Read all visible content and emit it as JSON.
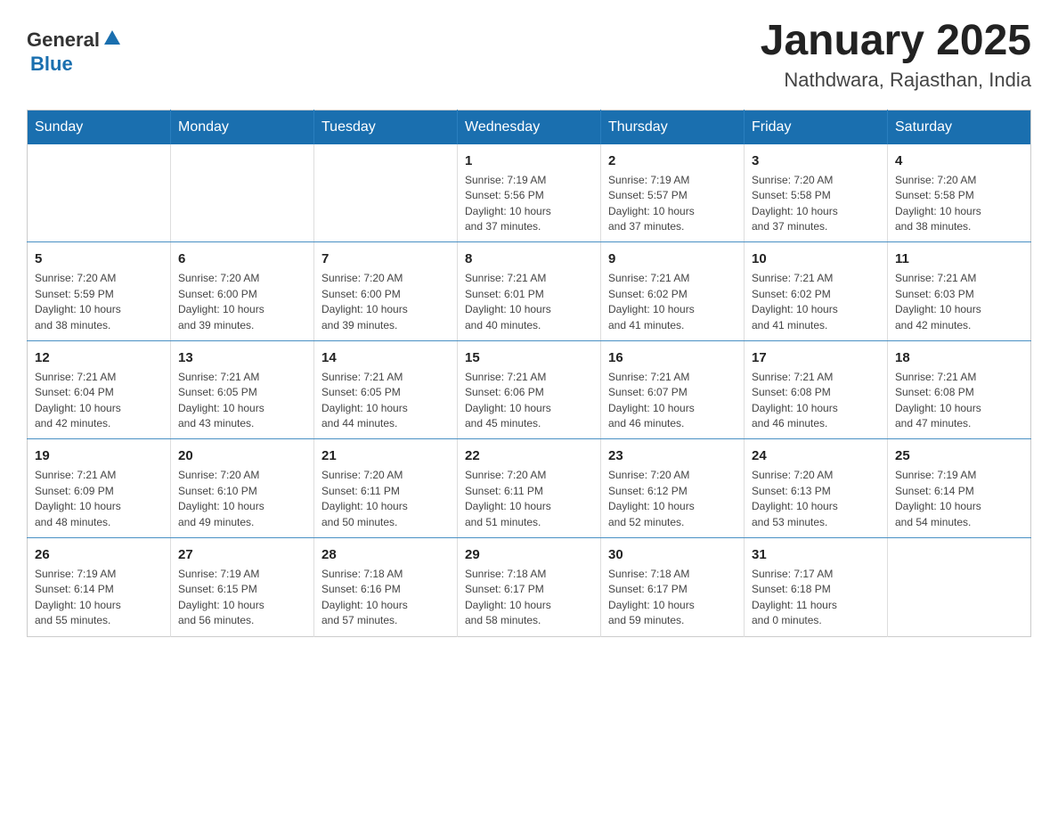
{
  "header": {
    "logo_general": "General",
    "logo_blue": "Blue",
    "month_year": "January 2025",
    "location": "Nathdwara, Rajasthan, India"
  },
  "days_of_week": [
    "Sunday",
    "Monday",
    "Tuesday",
    "Wednesday",
    "Thursday",
    "Friday",
    "Saturday"
  ],
  "weeks": [
    [
      {
        "day": "",
        "info": ""
      },
      {
        "day": "",
        "info": ""
      },
      {
        "day": "",
        "info": ""
      },
      {
        "day": "1",
        "info": "Sunrise: 7:19 AM\nSunset: 5:56 PM\nDaylight: 10 hours\nand 37 minutes."
      },
      {
        "day": "2",
        "info": "Sunrise: 7:19 AM\nSunset: 5:57 PM\nDaylight: 10 hours\nand 37 minutes."
      },
      {
        "day": "3",
        "info": "Sunrise: 7:20 AM\nSunset: 5:58 PM\nDaylight: 10 hours\nand 37 minutes."
      },
      {
        "day": "4",
        "info": "Sunrise: 7:20 AM\nSunset: 5:58 PM\nDaylight: 10 hours\nand 38 minutes."
      }
    ],
    [
      {
        "day": "5",
        "info": "Sunrise: 7:20 AM\nSunset: 5:59 PM\nDaylight: 10 hours\nand 38 minutes."
      },
      {
        "day": "6",
        "info": "Sunrise: 7:20 AM\nSunset: 6:00 PM\nDaylight: 10 hours\nand 39 minutes."
      },
      {
        "day": "7",
        "info": "Sunrise: 7:20 AM\nSunset: 6:00 PM\nDaylight: 10 hours\nand 39 minutes."
      },
      {
        "day": "8",
        "info": "Sunrise: 7:21 AM\nSunset: 6:01 PM\nDaylight: 10 hours\nand 40 minutes."
      },
      {
        "day": "9",
        "info": "Sunrise: 7:21 AM\nSunset: 6:02 PM\nDaylight: 10 hours\nand 41 minutes."
      },
      {
        "day": "10",
        "info": "Sunrise: 7:21 AM\nSunset: 6:02 PM\nDaylight: 10 hours\nand 41 minutes."
      },
      {
        "day": "11",
        "info": "Sunrise: 7:21 AM\nSunset: 6:03 PM\nDaylight: 10 hours\nand 42 minutes."
      }
    ],
    [
      {
        "day": "12",
        "info": "Sunrise: 7:21 AM\nSunset: 6:04 PM\nDaylight: 10 hours\nand 42 minutes."
      },
      {
        "day": "13",
        "info": "Sunrise: 7:21 AM\nSunset: 6:05 PM\nDaylight: 10 hours\nand 43 minutes."
      },
      {
        "day": "14",
        "info": "Sunrise: 7:21 AM\nSunset: 6:05 PM\nDaylight: 10 hours\nand 44 minutes."
      },
      {
        "day": "15",
        "info": "Sunrise: 7:21 AM\nSunset: 6:06 PM\nDaylight: 10 hours\nand 45 minutes."
      },
      {
        "day": "16",
        "info": "Sunrise: 7:21 AM\nSunset: 6:07 PM\nDaylight: 10 hours\nand 46 minutes."
      },
      {
        "day": "17",
        "info": "Sunrise: 7:21 AM\nSunset: 6:08 PM\nDaylight: 10 hours\nand 46 minutes."
      },
      {
        "day": "18",
        "info": "Sunrise: 7:21 AM\nSunset: 6:08 PM\nDaylight: 10 hours\nand 47 minutes."
      }
    ],
    [
      {
        "day": "19",
        "info": "Sunrise: 7:21 AM\nSunset: 6:09 PM\nDaylight: 10 hours\nand 48 minutes."
      },
      {
        "day": "20",
        "info": "Sunrise: 7:20 AM\nSunset: 6:10 PM\nDaylight: 10 hours\nand 49 minutes."
      },
      {
        "day": "21",
        "info": "Sunrise: 7:20 AM\nSunset: 6:11 PM\nDaylight: 10 hours\nand 50 minutes."
      },
      {
        "day": "22",
        "info": "Sunrise: 7:20 AM\nSunset: 6:11 PM\nDaylight: 10 hours\nand 51 minutes."
      },
      {
        "day": "23",
        "info": "Sunrise: 7:20 AM\nSunset: 6:12 PM\nDaylight: 10 hours\nand 52 minutes."
      },
      {
        "day": "24",
        "info": "Sunrise: 7:20 AM\nSunset: 6:13 PM\nDaylight: 10 hours\nand 53 minutes."
      },
      {
        "day": "25",
        "info": "Sunrise: 7:19 AM\nSunset: 6:14 PM\nDaylight: 10 hours\nand 54 minutes."
      }
    ],
    [
      {
        "day": "26",
        "info": "Sunrise: 7:19 AM\nSunset: 6:14 PM\nDaylight: 10 hours\nand 55 minutes."
      },
      {
        "day": "27",
        "info": "Sunrise: 7:19 AM\nSunset: 6:15 PM\nDaylight: 10 hours\nand 56 minutes."
      },
      {
        "day": "28",
        "info": "Sunrise: 7:18 AM\nSunset: 6:16 PM\nDaylight: 10 hours\nand 57 minutes."
      },
      {
        "day": "29",
        "info": "Sunrise: 7:18 AM\nSunset: 6:17 PM\nDaylight: 10 hours\nand 58 minutes."
      },
      {
        "day": "30",
        "info": "Sunrise: 7:18 AM\nSunset: 6:17 PM\nDaylight: 10 hours\nand 59 minutes."
      },
      {
        "day": "31",
        "info": "Sunrise: 7:17 AM\nSunset: 6:18 PM\nDaylight: 11 hours\nand 0 minutes."
      },
      {
        "day": "",
        "info": ""
      }
    ]
  ]
}
